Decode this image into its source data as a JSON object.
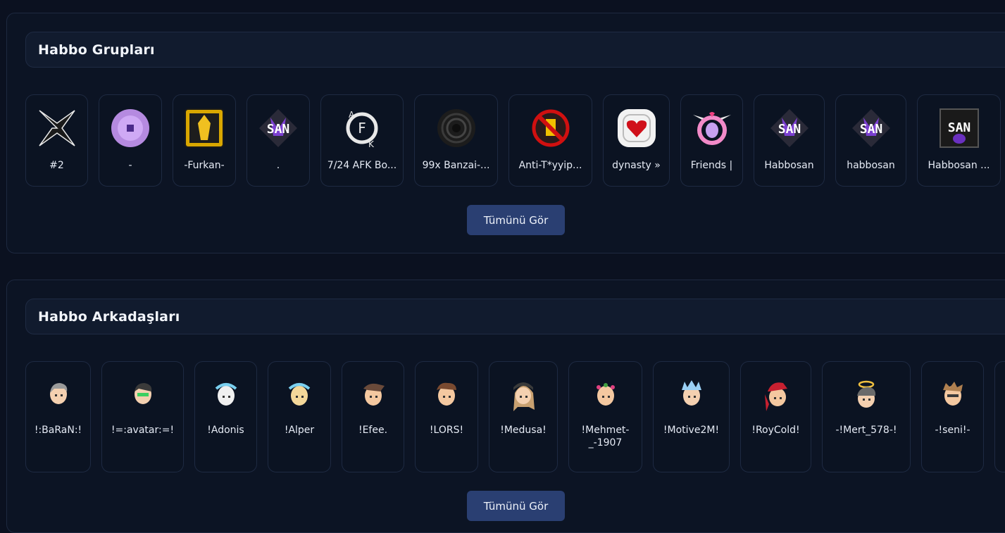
{
  "groups": {
    "title": "Habbo Grupları",
    "view_all": "Tümünü Gör",
    "items": [
      {
        "label": "#2",
        "icon": "star-badge-icon"
      },
      {
        "label": "-",
        "icon": "purple-orb-badge-icon"
      },
      {
        "label": "-Furkan-",
        "icon": "gold-crest-badge-icon"
      },
      {
        "label": ".",
        "icon": "san-badge-icon"
      },
      {
        "label": "7/24 AFK Bo...",
        "icon": "afk-badge-icon"
      },
      {
        "label": "99x Banzai-...",
        "icon": "spiral-badge-icon"
      },
      {
        "label": "Anti-T*yyip...",
        "icon": "no-sign-badge-icon"
      },
      {
        "label": "dynasty »",
        "icon": "heart-badge-icon"
      },
      {
        "label": "Friends |",
        "icon": "winged-ring-badge-icon"
      },
      {
        "label": "Habbosan",
        "icon": "san-badge-icon"
      },
      {
        "label": "habbosan",
        "icon": "san-badge-icon"
      },
      {
        "label": "Habbosan ...",
        "icon": "san-dark-badge-icon"
      }
    ]
  },
  "friends": {
    "title": "Habbo Arkadaşları",
    "view_all": "Tümünü Gör",
    "items": [
      {
        "label": "!:BaRaN:!",
        "icon": "avatar-icon"
      },
      {
        "label": "!=:avatar:=!",
        "icon": "avatar-icon"
      },
      {
        "label": "!Adonis",
        "icon": "avatar-icon"
      },
      {
        "label": "!Alper",
        "icon": "avatar-icon"
      },
      {
        "label": "!Efee.",
        "icon": "avatar-icon"
      },
      {
        "label": "!LORS!",
        "icon": "avatar-icon"
      },
      {
        "label": "!Medusa!",
        "icon": "avatar-icon"
      },
      {
        "label": "!Mehmet-_-1907",
        "icon": "avatar-icon"
      },
      {
        "label": "!Motive2M!",
        "icon": "avatar-icon"
      },
      {
        "label": "!RoyCold!",
        "icon": "avatar-icon"
      },
      {
        "label": "-!Mert_578-!",
        "icon": "avatar-icon"
      },
      {
        "label": "-!seni!-",
        "icon": "avatar-icon"
      },
      {
        "label": "",
        "icon": "avatar-icon"
      }
    ]
  }
}
